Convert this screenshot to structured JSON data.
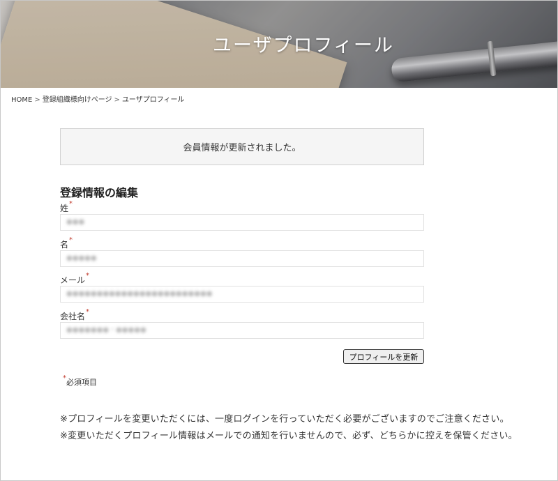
{
  "hero": {
    "title": "ユーザプロフィール"
  },
  "breadcrumb": {
    "items": [
      "HOME",
      "登録組織様向けページ",
      "ユーザプロフィール"
    ],
    "separator": ">"
  },
  "notice": {
    "message": "会員情報が更新されました。"
  },
  "form": {
    "title": "登録情報の編集",
    "required_mark": "*",
    "fields": [
      {
        "label": "姓",
        "value": "●●●"
      },
      {
        "label": "名",
        "value": "●●●●●"
      },
      {
        "label": "メール",
        "value": "●●●●●●●●●●●●●●●●●●●●●●●●"
      },
      {
        "label": "会社名",
        "value": "●●●●●●●・●●●●●"
      }
    ],
    "submit_label": "プロフィールを更新",
    "required_note": "必須項目"
  },
  "notes": [
    "※プロフィールを変更いただくには、一度ログインを行っていただく必要がございますのでご注意ください。",
    "※変更いただくプロフィール情報はメールでの通知を行いませんので、必ず、どちらかに控えを保管ください。"
  ],
  "colors": {
    "required": "#c0392b",
    "notice_bg": "#f5f5f5"
  }
}
